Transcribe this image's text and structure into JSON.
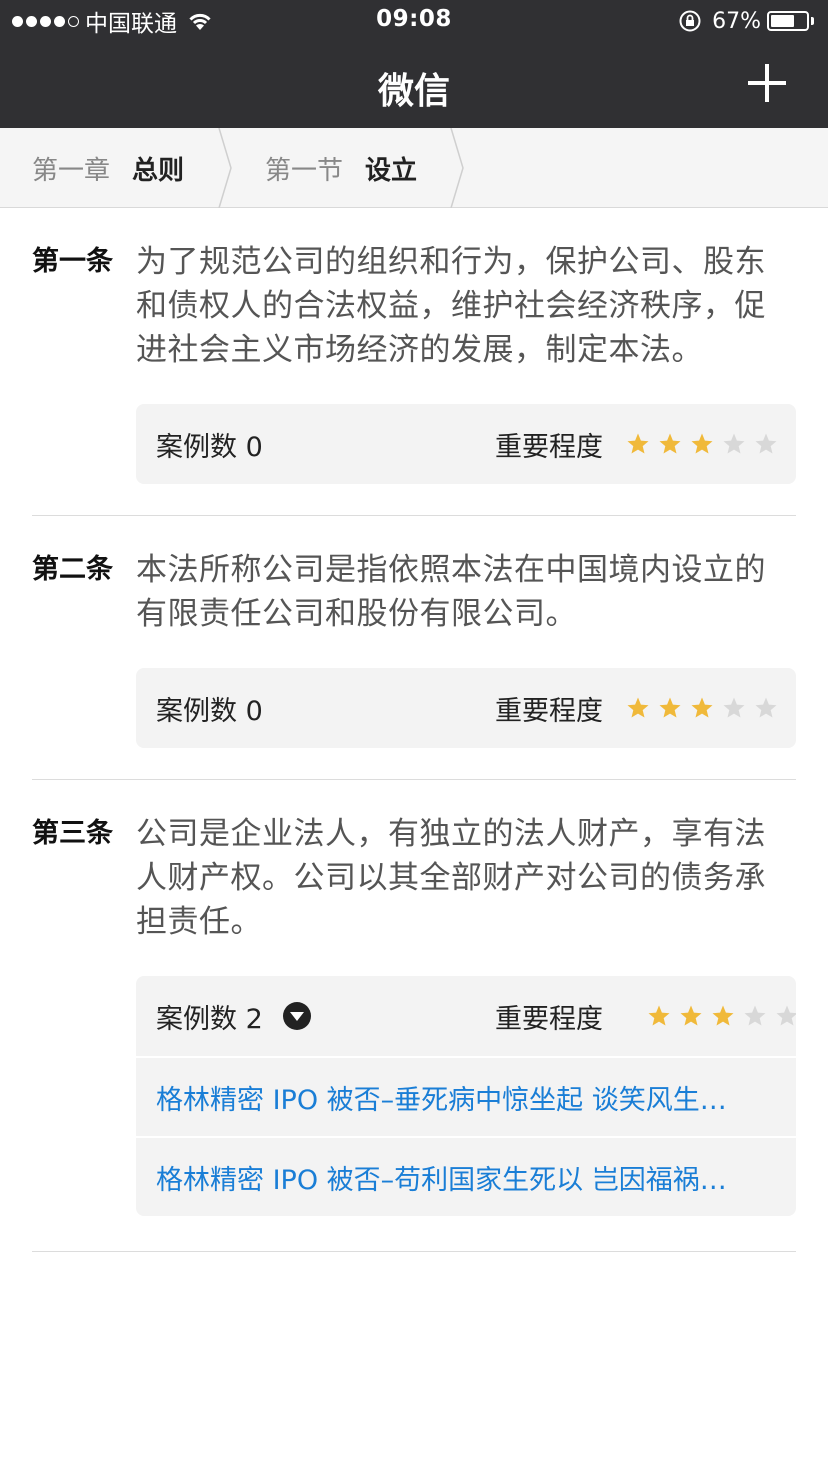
{
  "status_bar": {
    "carrier": "中国联通",
    "time": "09:08",
    "battery_percent": "67%",
    "battery_level": 0.67,
    "signal_bars_filled": 4,
    "signal_bars_total": 5
  },
  "nav": {
    "title": "微信",
    "add_icon": "plus-icon"
  },
  "breadcrumb": {
    "chapter_level": "第一章",
    "chapter_name": "总则",
    "section_level": "第一节",
    "section_name": "设立"
  },
  "articles": [
    {
      "label": "第一条",
      "text": "为了规范公司的组织和行为，保护公司、股东和债权人的合法权益，维护社会经济秩序，促进社会主义市场经济的发展，制定本法。",
      "cases": "案例数 0",
      "importance_label": "重要程度",
      "importance": 3,
      "importance_max": 5
    },
    {
      "label": "第二条",
      "text": "本法所称公司是指依照本法在中国境内设立的有限责任公司和股份有限公司。",
      "cases": "案例数 0",
      "importance_label": "重要程度",
      "importance": 3,
      "importance_max": 5
    },
    {
      "label": "第三条",
      "text": "公司是企业法人，有独立的法人财产，享有法人财产权。公司以其全部财产对公司的债务承担责任。",
      "cases": "案例数 2",
      "importance_label": "重要程度",
      "importance": 3,
      "importance_max": 5,
      "case_links": [
        "格林精密 IPO 被否–垂死病中惊坐起 谈笑风生…",
        "格林精密 IPO 被否–苟利国家生死以 岂因福祸…"
      ]
    }
  ],
  "colors": {
    "bar_bg": "#303033",
    "star_on": "#f0b93a",
    "star_off": "#d8d8d8",
    "link": "#1a7ed6"
  }
}
